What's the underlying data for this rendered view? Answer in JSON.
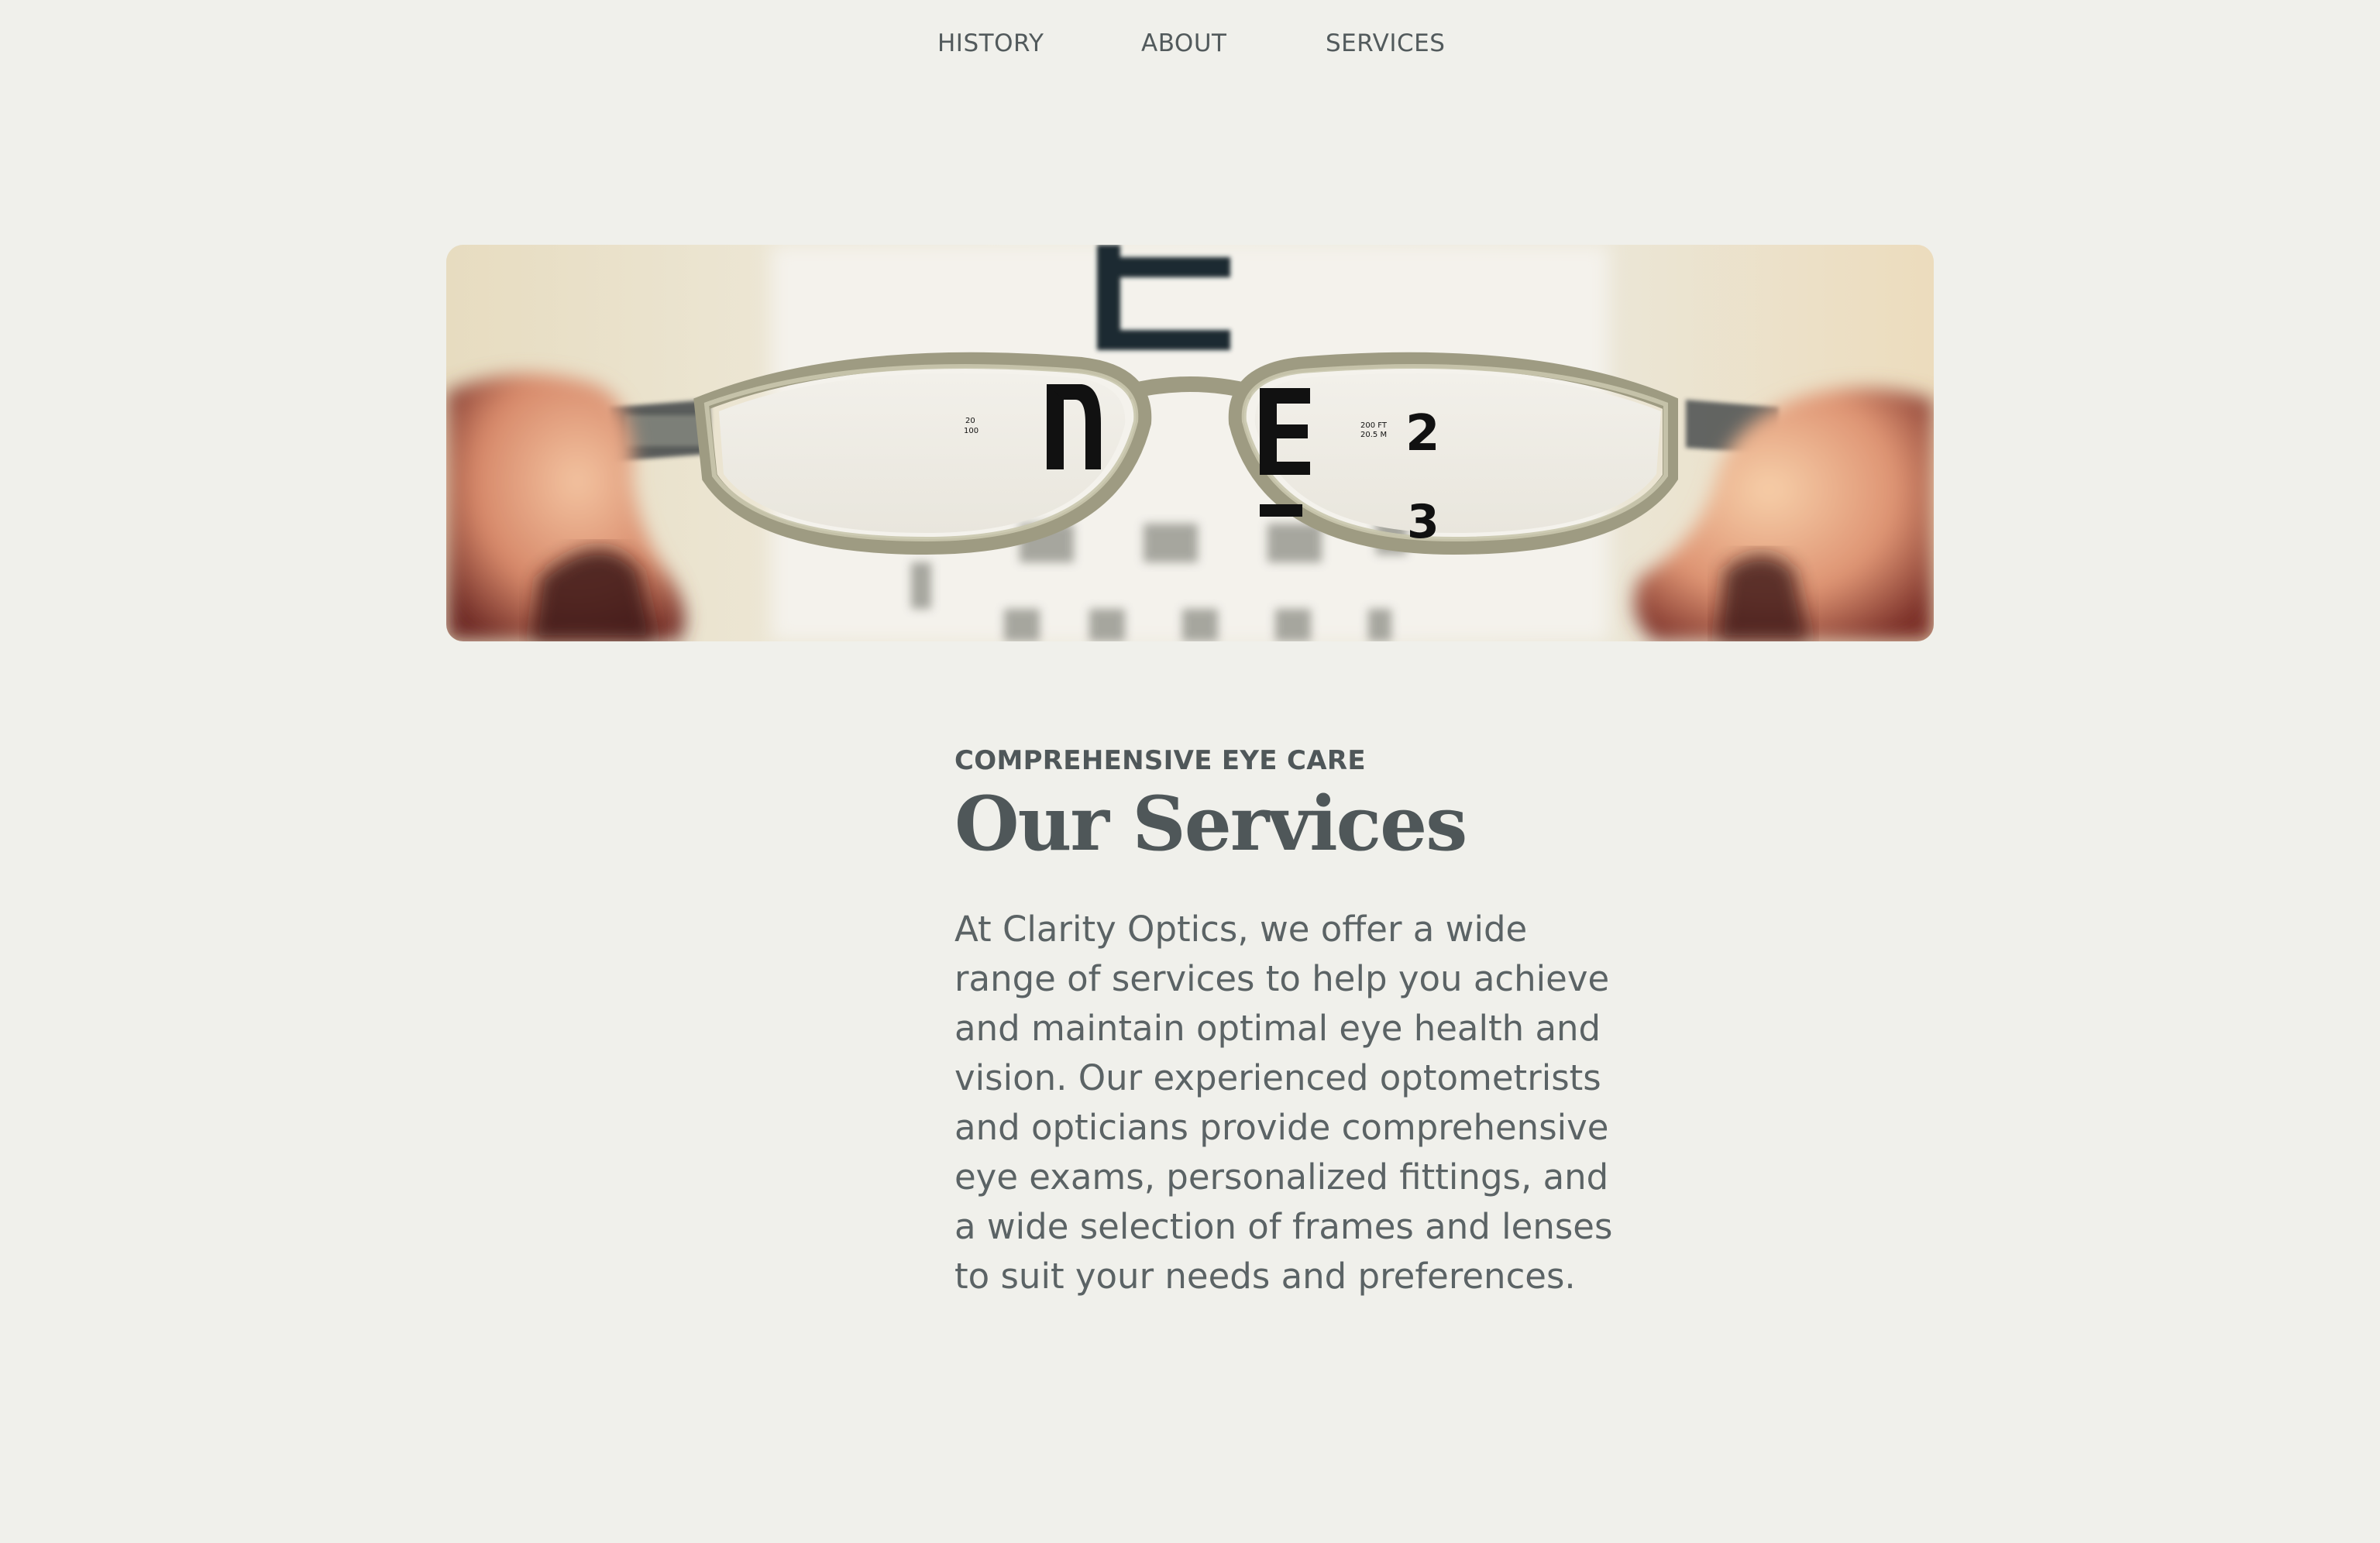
{
  "nav": {
    "items": [
      {
        "label": "HISTORY"
      },
      {
        "label": "ABOUT"
      },
      {
        "label": "SERVICES"
      }
    ]
  },
  "hero": {
    "image": "eyeglasses-held-before-eye-chart"
  },
  "section": {
    "eyebrow": "COMPREHENSIVE EYE CARE",
    "title": "Our Services",
    "body": "At Clarity Optics, we offer a wide range of services to help you achieve and maintain optimal eye health and vision. Our experienced optometrists and opticians provide comprehensive eye exams, personalized fittings, and a wide selection of frames and lenses to suit your needs and preferences."
  },
  "colors": {
    "background": "#f0f0eb",
    "text": "#525a5c"
  }
}
